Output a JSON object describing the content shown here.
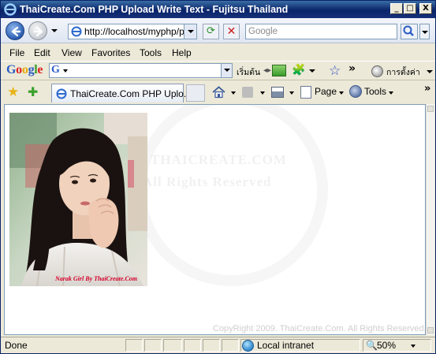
{
  "window": {
    "title": "ThaiCreate.Com PHP Upload Write Text - Fujitsu Thailand",
    "controls": {
      "minimize": "_",
      "maximize": "□",
      "close": "X"
    }
  },
  "address_bar": {
    "url": "http://localhost/myphp/ph",
    "search_placeholder": "Google"
  },
  "menu": [
    "File",
    "Edit",
    "View",
    "Favorites",
    "Tools",
    "Help"
  ],
  "google_toolbar": {
    "logo": "Google",
    "search_letter": "G",
    "start_label": "เริ่มต้น",
    "settings_label": "การตั้งค่า",
    "more": "»"
  },
  "tab": {
    "title": "ThaiCreate.Com PHP Uplo..."
  },
  "commands": {
    "page": "Page",
    "tools": "Tools",
    "more": "»"
  },
  "content": {
    "image_caption": "Narak Girl By ThaiCreate.Com",
    "watermark_site": "THAICREATE.COM",
    "watermark_rights": "All Rights Reserved",
    "copyright": "CopyRight 2009. ThaiCreate.Com. All Rights Reserved."
  },
  "status": {
    "text": "Done",
    "zone": "Local intranet",
    "zoom": "50%"
  },
  "colors": {
    "title_bar": "#0a246a",
    "chrome": "#ece9d8",
    "caption": "#d4002a"
  },
  "icons": [
    "ie-logo-icon",
    "back-icon",
    "forward-icon",
    "refresh-icon",
    "stop-icon",
    "search-icon",
    "favorites-star-icon",
    "add-favorite-icon",
    "home-icon",
    "feeds-icon",
    "print-icon",
    "page-icon",
    "tools-icon",
    "globe-icon",
    "zoom-icon"
  ]
}
